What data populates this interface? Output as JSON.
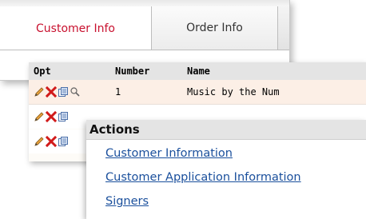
{
  "tabs": [
    {
      "label": "Customer Info",
      "active": true
    },
    {
      "label": "Order Info",
      "active": false
    }
  ],
  "grid": {
    "columns": {
      "opt": "Opt",
      "number": "Number",
      "name": "Name"
    },
    "rows": [
      {
        "number": "1",
        "name": "Music by the Num"
      }
    ]
  },
  "actions": {
    "title": "Actions",
    "items": [
      "Customer Information",
      "Customer Application Information",
      "Signers"
    ]
  },
  "colors": {
    "active_tab_text": "#c8102e",
    "link": "#1a4f9c",
    "header_bg": "#e4e4e4",
    "selected_row_bg": "#fcefe6"
  },
  "icons": [
    "edit-pencil-icon",
    "delete-x-icon",
    "copy-document-icon",
    "search-magnifier-icon"
  ]
}
